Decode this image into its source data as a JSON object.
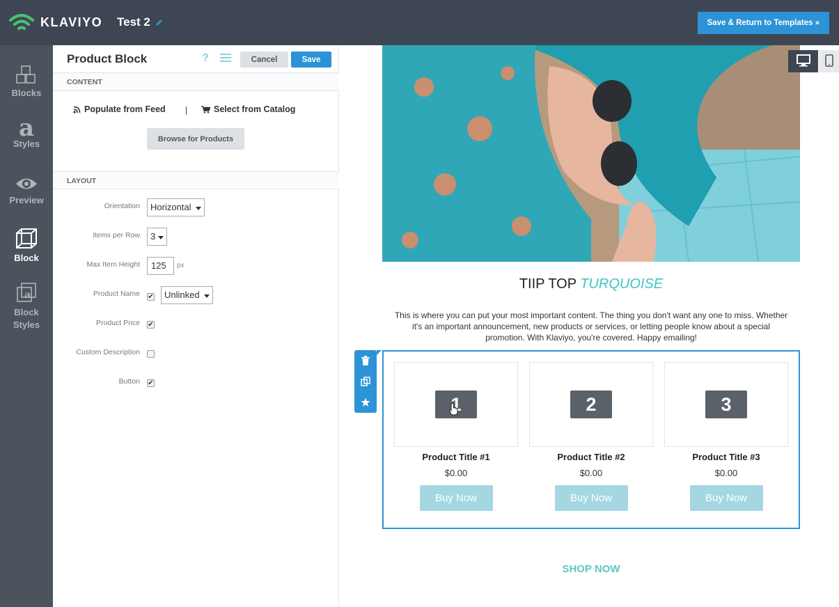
{
  "app": {
    "brand": "KLAVIYO",
    "document_title": "Test 2",
    "save_return_label": "Save & Return to Templates »"
  },
  "nav": {
    "items": [
      {
        "label": "Blocks",
        "icon": "blocks-icon"
      },
      {
        "label": "Styles",
        "icon": "styles-icon"
      },
      {
        "label": "Preview",
        "icon": "eye-icon"
      },
      {
        "label": "Block",
        "icon": "cube-icon",
        "active": true
      },
      {
        "label": "Block Styles",
        "icon": "block-styles-icon"
      }
    ]
  },
  "panel": {
    "title": "Product Block",
    "help_icon": "?",
    "cancel_label": "Cancel",
    "save_label": "Save",
    "content_section": "CONTENT",
    "populate_label": "Populate from Feed",
    "separator": "|",
    "catalog_label": "Select from Catalog",
    "browse_label": "Browse for Products",
    "layout_section": "LAYOUT",
    "orientation_label": "Orientation",
    "orientation_value": "Horizontal",
    "items_per_row_label": "Items per Row",
    "items_per_row_value": "3",
    "max_height_label": "Max Item Height",
    "max_height_value": "125",
    "max_height_unit": "px",
    "product_name_label": "Product Name",
    "product_name_checked": true,
    "product_name_link_value": "Unlinked",
    "product_price_label": "Product Price",
    "product_price_checked": true,
    "custom_description_label": "Custom Description",
    "custom_description_checked": false,
    "button_label": "Button",
    "button_checked": true
  },
  "canvas": {
    "headline_main": "TIIP TOP ",
    "headline_accent": "TURQUOISE",
    "body_text": "This is where you can put your most important content. The thing you don't want any one to miss. Whether it's an important announcement, new products or services, or letting people know about a special promotion. With Klaviyo, you're covered. Happy emailing!",
    "products": [
      {
        "number": "1",
        "title": "Product Title #1",
        "price": "$0.00",
        "button": "Buy Now"
      },
      {
        "number": "2",
        "title": "Product Title #2",
        "price": "$0.00",
        "button": "Buy Now"
      },
      {
        "number": "3",
        "title": "Product Title #3",
        "price": "$0.00",
        "button": "Buy Now"
      }
    ],
    "shop_now": "SHOP NOW"
  },
  "colors": {
    "topbar": "#3e4653",
    "nav": "#4b535c",
    "accent_blue": "#2b93d6",
    "turquoise": "#43c2c7",
    "buy_button": "#a5d7e2"
  }
}
